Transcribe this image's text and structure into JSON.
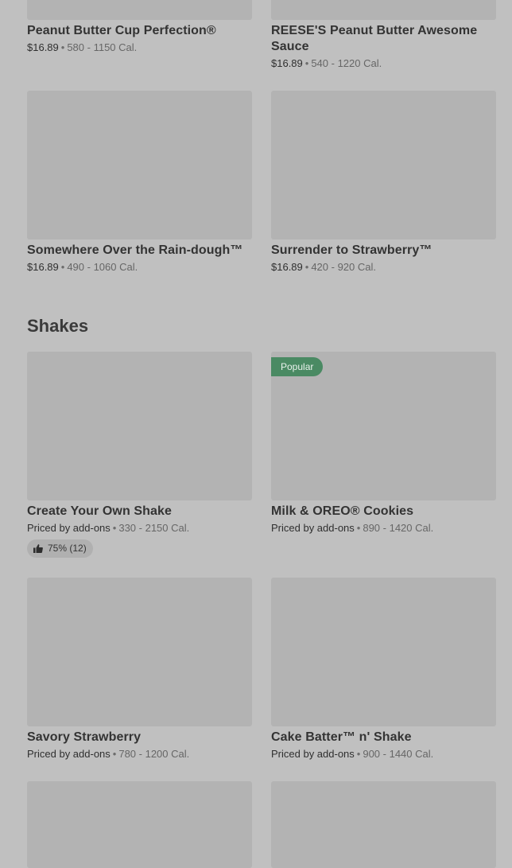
{
  "items_top": [
    {
      "name": "Peanut Butter Cup Perfection®",
      "price": "$16.89",
      "calories": "580 - 1150 Cal."
    },
    {
      "name": "REESE'S Peanut Butter Awesome Sauce",
      "price": "$16.89",
      "calories": "540 - 1220 Cal."
    },
    {
      "name": "Somewhere Over the Rain-dough™",
      "price": "$16.89",
      "calories": "490 - 1060 Cal."
    },
    {
      "name": "Surrender to Strawberry™",
      "price": "$16.89",
      "calories": "420 - 920 Cal."
    }
  ],
  "separator": "•",
  "shakes_section": {
    "title": "Shakes",
    "items": [
      {
        "name": "Create Your Own Shake",
        "price": "Priced by add-ons",
        "calories": "330 - 2150 Cal.",
        "rating": "75% (12)"
      },
      {
        "name": "Milk & OREO® Cookies",
        "price": "Priced by add-ons",
        "calories": "890 - 1420 Cal.",
        "badge": "Popular"
      },
      {
        "name": "Savory Strawberry",
        "price": "Priced by add-ons",
        "calories": "780 - 1200 Cal."
      },
      {
        "name": "Cake Batter™ n' Shake",
        "price": "Priced by add-ons",
        "calories": "900 - 1440 Cal."
      }
    ]
  },
  "icons": {
    "rating": "thumbs-up-icon"
  },
  "colors": {
    "background": "#c0c0c0",
    "image_placeholder": "#b3b3b3",
    "popular_badge": "#4a8a63"
  }
}
